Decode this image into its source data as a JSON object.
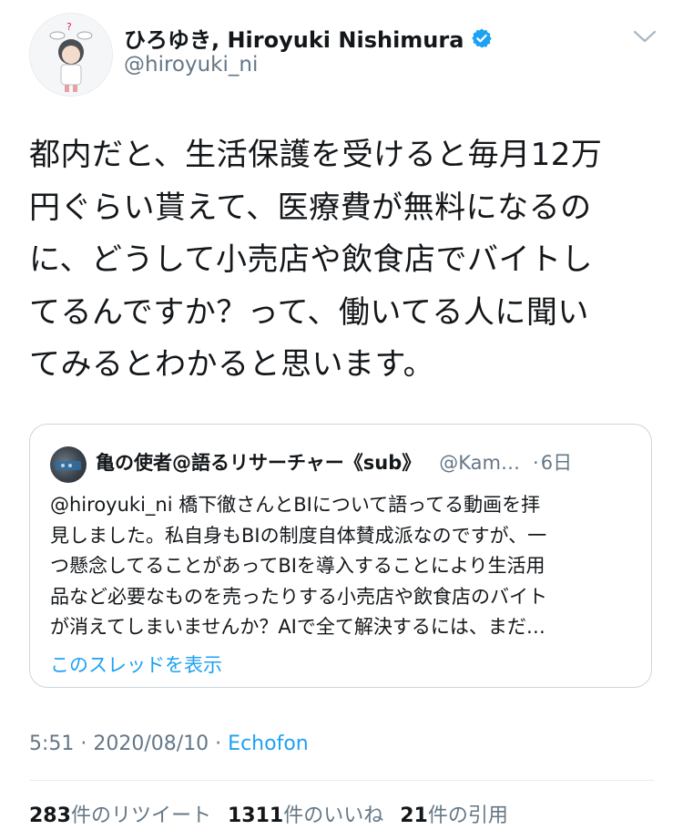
{
  "author": {
    "display_name": "ひろゆき, Hiroyuki Nishimura",
    "handle": "@hiroyuki_ni",
    "verified": true
  },
  "tweet": {
    "lines": [
      "都内だと、生活保護を受けると毎月12万",
      "円ぐらい貰えて、医療費が無料になるの",
      "に、どうして小売店や飲食店でバイトし",
      "てるんですか？って、働いてる人に聞い",
      "てみるとわかると思います。"
    ]
  },
  "quote": {
    "name": "亀の使者@語るリサーチャー《sub》",
    "handle": "@Kam…",
    "dot": "·",
    "time": "6日",
    "lines": [
      "@hiroyuki_ni 橋下徹さんとBIについて語ってる動画を拝",
      "見しました。私自身もBIの制度自体賛成派なのですが、一",
      "つ懸念してることがあってBIを導入することにより生活用",
      "品など必要なものを売ったりする小売店や飲食店のバイト",
      "が消えてしまいませんか？AIで全て解決するには、まだ…"
    ],
    "show_thread": "このスレッドを表示"
  },
  "meta": {
    "time": "5:51 · 2020/08/10 · ",
    "source": "Echofon"
  },
  "stats": [
    {
      "num": "283",
      "label": "件のリツイート"
    },
    {
      "num": "1311",
      "label": "件のいいね"
    },
    {
      "num": "21",
      "label": "件の引用"
    }
  ],
  "colors": {
    "link": "#1da1f2",
    "secondary_text": "#657786",
    "border": "#ccd6dd"
  },
  "icons": {
    "verified": "verified-badge-icon",
    "menu": "chevron-down-icon"
  }
}
